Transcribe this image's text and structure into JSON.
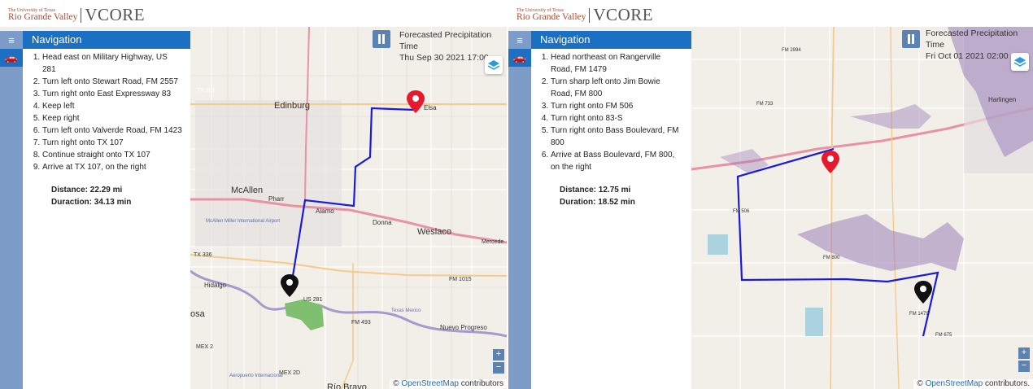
{
  "brand": {
    "university_small": "The University of Texas",
    "university_big": "Rio Grande Valley",
    "product": "VCORE"
  },
  "left": {
    "nav_title": "Navigation",
    "steps": [
      "Head east on Military Highway, US 281",
      "Turn left onto Stewart Road, FM 2557",
      "Turn right onto East Expressway 83",
      "Keep left",
      "Keep right",
      "Turn left onto Valverde Road, FM 1423",
      "Turn right onto TX 107",
      "Continue straight onto TX 107",
      "Arrive at TX 107, on the right"
    ],
    "distance": "Distance: 22.29 mi",
    "duration": "Duraction: 34.13 min",
    "forecast_title": "Forecasted Precipitation Time",
    "forecast_time": "Thu Sep 30 2021 17:00",
    "map_labels": {
      "edinburg": "Edinburg",
      "elsa": "Elsa",
      "mcallen": "McAllen",
      "pharr": "Pharr",
      "alamo": "Alamo",
      "donna": "Donna",
      "weslaco": "Weslaco",
      "mercedes": "Mercede",
      "hidalgo": "Hidalgo",
      "reynosa": "osa",
      "nuevo": "Nuevo Progreso",
      "rio_bravo": "Río Bravo",
      "airport": "McAllen Miller International Airport",
      "aeropuerto": "Aeropuerto Internacional",
      "tx107": "TX 107",
      "tx336": "TX 336",
      "us281": "US 281",
      "fm493": "FM 493",
      "fm1015": "FM 1015",
      "mex2": "MEX 2",
      "mex2d": "MEX 2D",
      "texas_mexico": "Texas Mexico"
    },
    "attribution_prefix": "© ",
    "attribution_link": "OpenStreetMap",
    "attribution_suffix": " contributors"
  },
  "right": {
    "nav_title": "Navigation",
    "steps": [
      "Head northeast on Rangerville Road, FM 1479",
      "Turn sharp left onto Jim Bowie Road, FM 800",
      "Turn right onto FM 506",
      "Turn right onto 83-S",
      "Turn right onto Bass Boulevard, FM 800",
      "Arrive at Bass Boulevard, FM 800, on the right"
    ],
    "distance": "Distance: 12.75 mi",
    "duration": "Duration: 18.52 min",
    "forecast_title": "Forecasted Precipitation Time",
    "forecast_time": "Fri Oct 01 2021 02:00",
    "map_labels": {
      "harlingen": "Harlingen",
      "fm506": "FM 506",
      "fm800": "FM 800",
      "fm1479": "FM 1479",
      "fm2994": "FM 2994",
      "fm733": "FM 733",
      "fm675": "FM 675"
    },
    "attribution_prefix": "© ",
    "attribution_link": "OpenStreetMap",
    "attribution_suffix": " contributors."
  },
  "colors": {
    "nav_blue": "#1c70c4",
    "route": "#1a1adb",
    "destination_pin": "#e8192c",
    "origin_pin": "#111111",
    "precip": "#9a7fb8"
  },
  "icons": {
    "menu": "menu-icon",
    "car": "car-icon",
    "layers": "layers-icon",
    "pause": "pause-icon"
  }
}
